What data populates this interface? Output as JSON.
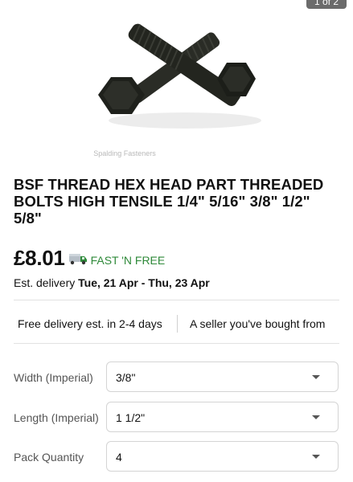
{
  "gallery": {
    "counter": "1 of 2",
    "watermark": "Spalding Fasteners"
  },
  "product": {
    "title": "BSF THREAD HEX HEAD PART THREADED BOLTS HIGH TENSILE  1/4\" 5/16\" 3/8\" 1/2\" 5/8\"",
    "price": "£8.01",
    "shipping_badge": "FAST 'N FREE",
    "shipping_icon": "delivery-truck-icon",
    "delivery_prefix": "Est. delivery",
    "delivery_dates": "Tue, 21 Apr - Thu, 23 Apr"
  },
  "highlights": {
    "free_delivery": "Free delivery est. in 2-4 days",
    "seller_note": "A seller you've bought from"
  },
  "options": [
    {
      "label": "Width (Imperial)",
      "value": "3/8\""
    },
    {
      "label": "Length (Imperial)",
      "value": "1 1/2\""
    },
    {
      "label": "Pack Quantity",
      "value": "4"
    }
  ],
  "colors": {
    "fast_free_green": "#2f8a3a",
    "bolt_dark": "#1f211c"
  }
}
